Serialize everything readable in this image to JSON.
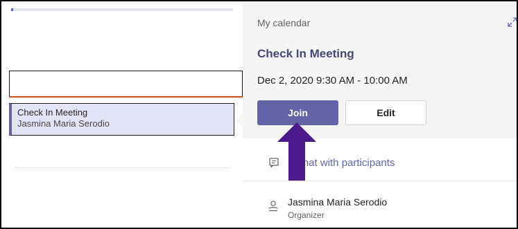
{
  "calendar": {
    "event": {
      "title": "Check In Meeting",
      "organizer": "Jasmina Maria Serodio"
    }
  },
  "details": {
    "section_label": "My calendar",
    "title": "Check In Meeting",
    "datetime": "Dec 2, 2020 9:30 AM - 10:00 AM",
    "join_label": "Join",
    "edit_label": "Edit",
    "chat_label": "Chat with participants",
    "organizer_name": "Jasmina Maria Serodio",
    "organizer_role": "Organizer"
  },
  "icons": {
    "expand": "expand-icon",
    "chat": "chat-icon",
    "person": "person-icon"
  },
  "colors": {
    "brand": "#6264a7",
    "event_bg": "#e2e3f5",
    "now_line": "#c4501d",
    "annotation_arrow": "#4b1a8c"
  }
}
